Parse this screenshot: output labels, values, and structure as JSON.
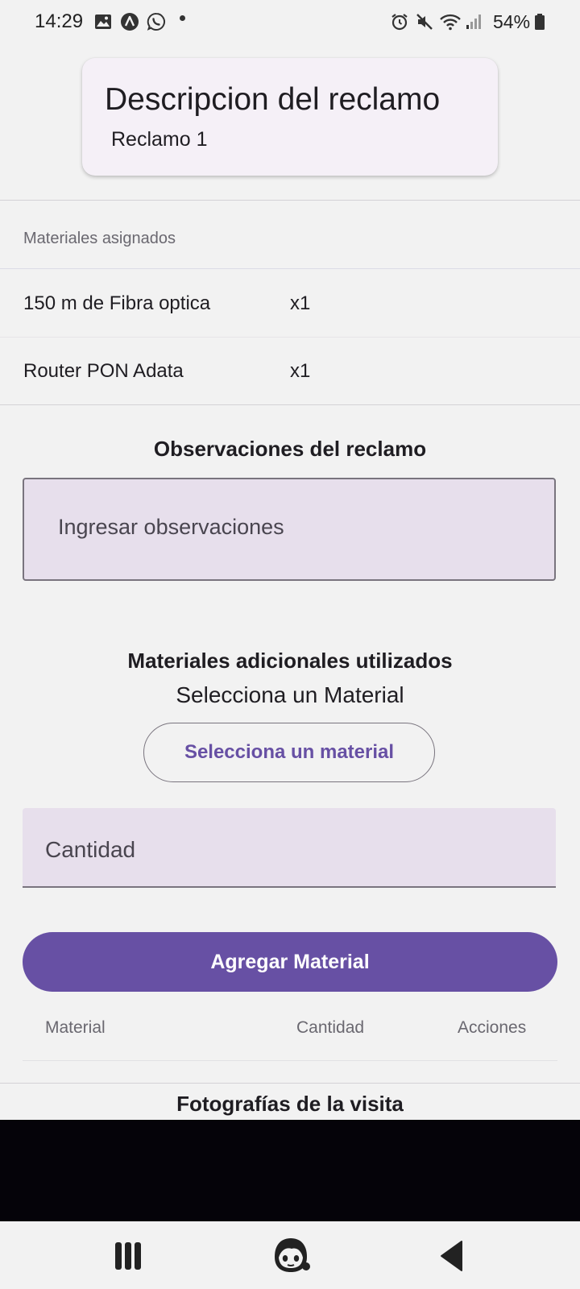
{
  "status_bar": {
    "time": "14:29",
    "battery": "54%",
    "icons": [
      "gallery-icon",
      "app-a-icon",
      "whatsapp-icon",
      "alarm-icon",
      "mute-icon",
      "wifi-icon",
      "signal-icon",
      "battery-icon"
    ]
  },
  "header": {
    "title": "Descripcion del reclamo",
    "subtitle": "Reclamo 1"
  },
  "assigned_materials": {
    "caption": "Materiales asignados",
    "rows": [
      {
        "name": "150 m de Fibra optica",
        "qty": "x1"
      },
      {
        "name": "Router PON Adata",
        "qty": "x1"
      }
    ]
  },
  "observations": {
    "heading": "Observaciones del reclamo",
    "placeholder": "Ingresar observaciones"
  },
  "additional_materials": {
    "heading": "Materiales adicionales utilizados",
    "select_caption": "Selecciona un Material",
    "select_button": "Selecciona un material",
    "quantity_placeholder": "Cantidad",
    "add_button": "Agregar Material",
    "table_headers": [
      "Material",
      "Cantidad",
      "Acciones"
    ]
  },
  "photos": {
    "heading": "Fotografías de la visita"
  },
  "nav": {
    "icons": [
      "recent-apps-icon",
      "home-icon",
      "back-icon"
    ]
  },
  "colors": {
    "primary": "#6750a4",
    "field_fill": "#e7dfec",
    "card_fill": "#f5f0f7",
    "background": "#f2f2f2"
  }
}
